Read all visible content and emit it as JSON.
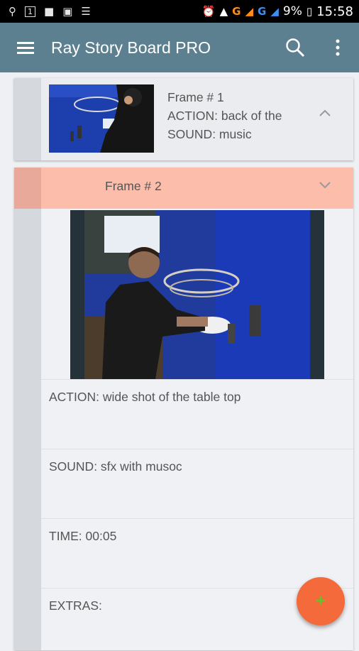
{
  "status_bar": {
    "time": "15:58",
    "battery": "9%",
    "network1": "G",
    "network2": "G",
    "sim_badge": "1"
  },
  "app_bar": {
    "title": "Ray Story Board PRO",
    "icons": [
      "menu-icon",
      "search-icon",
      "more-vert-icon"
    ]
  },
  "frames": [
    {
      "title": "Frame # 1",
      "action": "ACTION: back of the",
      "sound": "SOUND: music",
      "expanded": false
    },
    {
      "title": "Frame # 2",
      "expanded": true,
      "action": "ACTION: wide shot of the table top",
      "sound": "SOUND: sfx with musoc",
      "time": "TIME: 00:05",
      "extras": "EXTRAS:"
    }
  ],
  "fab": {
    "label": "+"
  },
  "colors": {
    "app_bar": "#5d8090",
    "frame_header_highlight": "#fcbdaa",
    "fab": "#f46a3a"
  }
}
